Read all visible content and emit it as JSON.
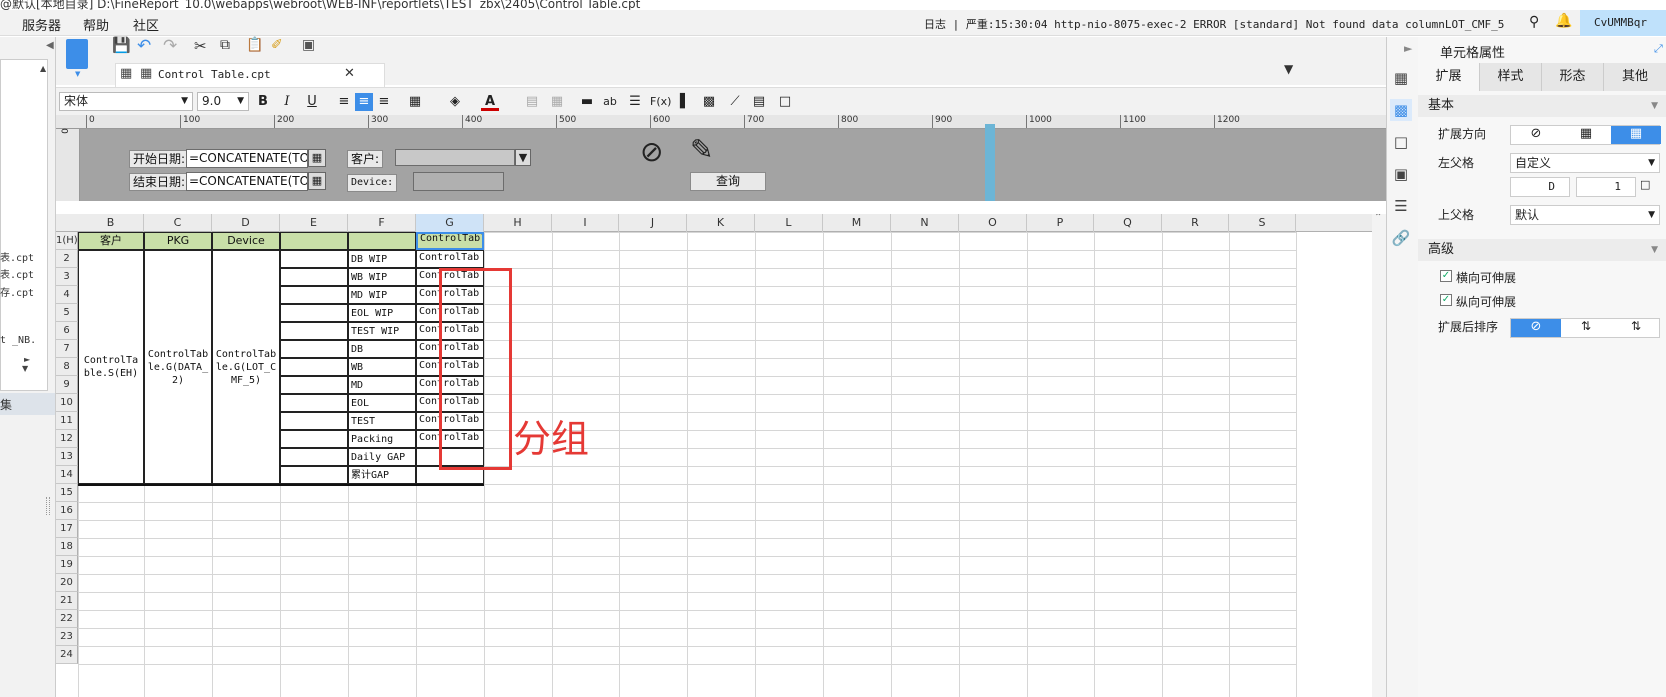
{
  "window": {
    "title": "@默认[本地目录]   D:\\FineReport_10.0\\webapps\\webroot\\WEB-INF\\reportlets\\TEST_zbx\\2405\\Control Table.cpt"
  },
  "menu": {
    "items": [
      "服务器",
      "帮助",
      "社区"
    ]
  },
  "log": {
    "text": "日志 | 严重:15:30:04 http-nio-8075-exec-2 ERROR [standard] Not found data columnLOT_CMF_5"
  },
  "user": {
    "name": "CvUMMBqr"
  },
  "left_panel": {
    "items": [
      "表.cpt",
      "表.cpt",
      "存.cpt",
      "t _NB.",
      "集"
    ]
  },
  "tab": {
    "label": "Control Table.cpt"
  },
  "format": {
    "font": "宋体",
    "size": "9.0"
  },
  "ruler": {
    "ticks": [
      "0",
      "100",
      "200",
      "300",
      "400",
      "500",
      "600",
      "700",
      "800",
      "900",
      "1000",
      "1100",
      "1200"
    ],
    "vtick": "0"
  },
  "params": {
    "start_label": "开始日期:",
    "start_value": "=CONCATENATE(TOD",
    "end_label": "结束日期:",
    "end_value": "=CONCATENATE(TOD",
    "customer_label": "客户:",
    "device_label": "Device:",
    "query_button": "查询"
  },
  "sheet": {
    "columns": [
      "B",
      "C",
      "D",
      "E",
      "F",
      "G",
      "H",
      "I",
      "J",
      "K",
      "L",
      "M",
      "N",
      "O",
      "P",
      "Q",
      "R",
      "S"
    ],
    "rows": [
      "1(H)",
      "2",
      "3",
      "4",
      "5",
      "6",
      "7",
      "8",
      "9",
      "10",
      "11",
      "12",
      "13",
      "14",
      "15",
      "16",
      "17",
      "18",
      "19",
      "20",
      "21",
      "22",
      "23",
      "24"
    ],
    "header_cells": [
      "客户",
      "PKG",
      "Device",
      "",
      "",
      "ControlTabl"
    ],
    "merged": {
      "b": "ControlTable.S(EH)",
      "c": "ControlTable.G(DATA_2)",
      "d": "ControlTable.G(LOT_CMF_5)"
    },
    "f_items": [
      "DB WIP",
      "WB WIP",
      "MD WIP",
      "EOL WIP",
      "TEST WIP",
      "DB",
      "WB",
      "MD",
      "EOL",
      "TEST",
      "Packing",
      "Daily GAP",
      "累计GAP"
    ],
    "g_items": [
      "ControlTab",
      "ControlTab",
      "ControlTab",
      "ControlTab",
      "ControlTab",
      "ControlTab",
      "ControlTab",
      "ControlTab",
      "ControlTab",
      "ControlTab",
      "ControlTab"
    ]
  },
  "annotation": {
    "text": "分组",
    "color": "#e53935"
  },
  "right_panel": {
    "title": "单元格属性",
    "tabs": [
      "扩展",
      "样式",
      "形态",
      "其他"
    ],
    "section_basic": "基本",
    "expand_direction_label": "扩展方向",
    "left_parent_label": "左父格",
    "left_parent_value": "自定义",
    "left_parent_cell": "D",
    "left_parent_num": "1",
    "top_parent_label": "上父格",
    "top_parent_value": "默认",
    "section_advanced": "高级",
    "horizontal_expand": "横向可伸展",
    "vertical_expand": "纵向可伸展",
    "sort_label": "扩展后排序"
  },
  "colors": {
    "accent": "#3d8ee8",
    "header_fill": "#c9dfa8",
    "selection": "#e53935"
  }
}
